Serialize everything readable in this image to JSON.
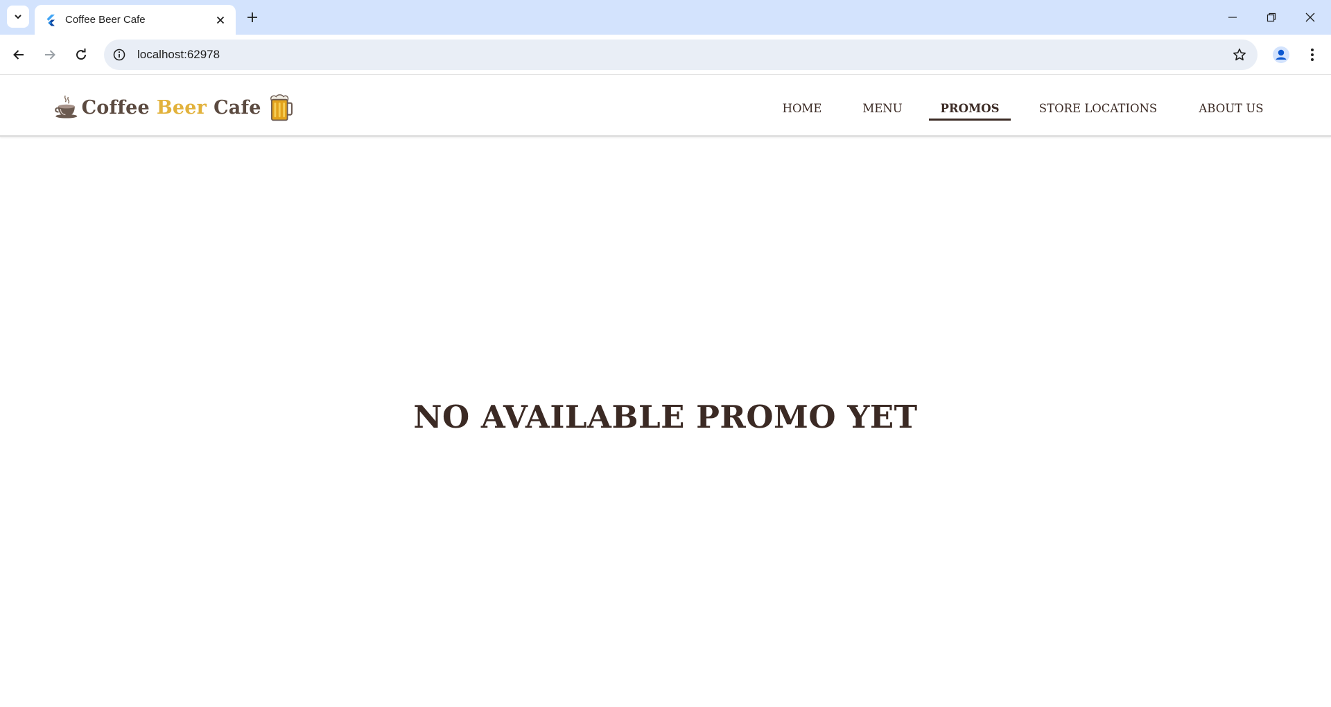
{
  "browser": {
    "tab": {
      "title": "Coffee Beer Cafe"
    },
    "address_bar": {
      "url": "localhost:62978"
    }
  },
  "site": {
    "logo": {
      "word1": "Coffee",
      "word2": "Beer",
      "word3": "Cafe"
    },
    "nav": [
      {
        "label": "HOME",
        "active": false
      },
      {
        "label": "MENU",
        "active": false
      },
      {
        "label": "PROMOS",
        "active": true
      },
      {
        "label": "STORE LOCATIONS",
        "active": false
      },
      {
        "label": "ABOUT US",
        "active": false
      }
    ],
    "colors": {
      "brand_brown": "#3b2a24",
      "brand_gold": "#e2b23c",
      "tabstrip_blue": "#d3e3fd"
    }
  },
  "main": {
    "message": "NO AVAILABLE PROMO YET"
  },
  "icons": [
    "tab-search-icon",
    "flutter-favicon-icon",
    "close-icon",
    "plus-icon",
    "minimize-icon",
    "restore-icon",
    "window-close-icon",
    "back-arrow-icon",
    "forward-arrow-icon",
    "reload-icon",
    "site-info-icon",
    "bookmark-star-icon",
    "profile-icon",
    "kebab-menu-icon"
  ]
}
